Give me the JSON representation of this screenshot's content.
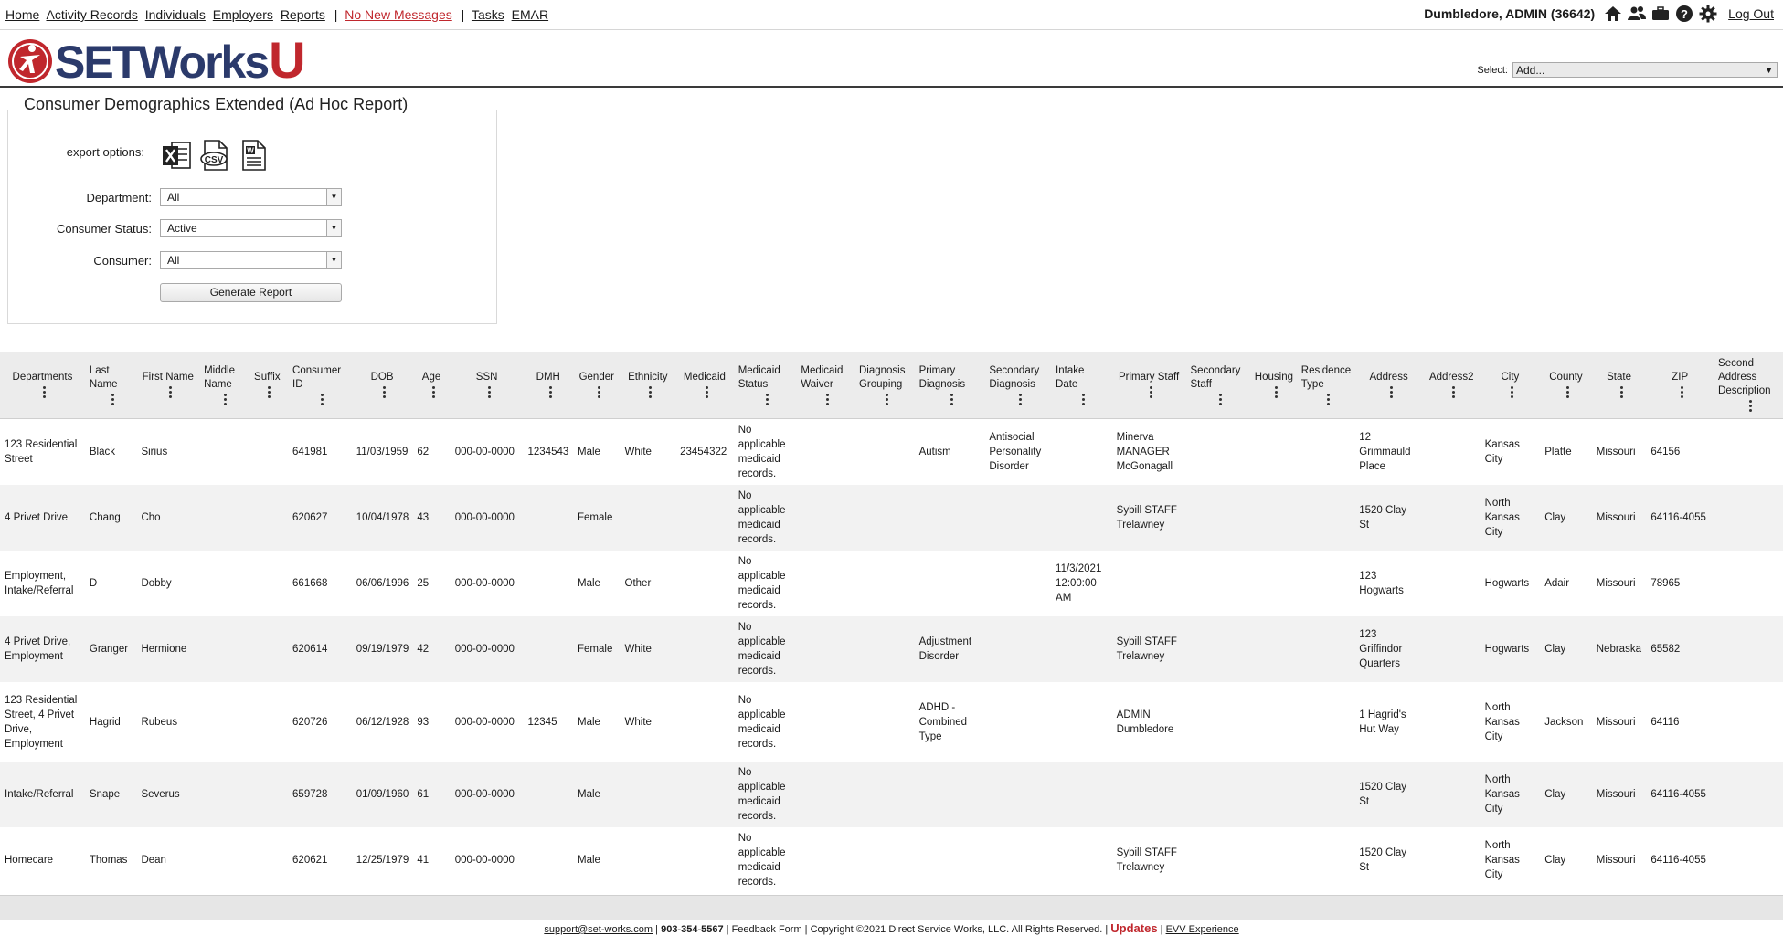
{
  "nav": {
    "links": [
      "Home",
      "Activity Records",
      "Individuals",
      "Employers",
      "Reports"
    ],
    "messages": "No New Messages",
    "links2": [
      "Tasks",
      "EMAR"
    ],
    "separator": "|"
  },
  "user": {
    "name": "Dumbledore, ADMIN",
    "id": "(36642)",
    "logout": "Log Out"
  },
  "logo": {
    "text": "SETWorks",
    "accent": "U"
  },
  "add_select": {
    "label": "Select:",
    "value": "Add..."
  },
  "report": {
    "title": "Consumer Demographics Extended (Ad Hoc Report)",
    "export_label": "export options:",
    "department_label": "Department:",
    "department_value": "All",
    "status_label": "Consumer Status:",
    "status_value": "Active",
    "consumer_label": "Consumer:",
    "consumer_value": "All",
    "generate_label": "Generate Report"
  },
  "table": {
    "columns": [
      "Departments",
      "Last Name",
      "First Name",
      "Middle Name",
      "Suffix",
      "Consumer ID",
      "DOB",
      "Age",
      "SSN",
      "DMH",
      "Gender",
      "Ethnicity",
      "Medicaid",
      "Medicaid Status",
      "Medicaid Waiver",
      "Diagnosis Grouping",
      "Primary Diagnosis",
      "Secondary Diagnosis",
      "Intake Date",
      "Primary Staff",
      "Secondary Staff",
      "Housing",
      "Residence Type",
      "Address",
      "Address2",
      "City",
      "County",
      "State",
      "ZIP",
      "Second Address Description"
    ],
    "rows": [
      [
        "123 Residential Street",
        "Black",
        "Sirius",
        "",
        "",
        "641981",
        "11/03/1959",
        "62",
        "000-00-0000",
        "1234543",
        "Male",
        "White",
        "23454322",
        "No applicable medicaid records.",
        "",
        "",
        "Autism",
        "Antisocial Personality Disorder",
        "",
        "Minerva MANAGER McGonagall",
        "",
        "",
        "",
        "12 Grimmauld Place",
        "",
        "Kansas City",
        "Platte",
        "Missouri",
        "64156",
        ""
      ],
      [
        "4 Privet Drive",
        "Chang",
        "Cho",
        "",
        "",
        "620627",
        "10/04/1978",
        "43",
        "000-00-0000",
        "",
        "Female",
        "",
        "",
        "No applicable medicaid records.",
        "",
        "",
        "",
        "",
        "",
        "Sybill STAFF Trelawney",
        "",
        "",
        "",
        "1520 Clay St",
        "",
        "North Kansas City",
        "Clay",
        "Missouri",
        "64116-4055",
        ""
      ],
      [
        "Employment, Intake/Referral",
        "D",
        "Dobby",
        "",
        "",
        "661668",
        "06/06/1996",
        "25",
        "000-00-0000",
        "",
        "Male",
        "Other",
        "",
        "No applicable medicaid records.",
        "",
        "",
        "",
        "",
        "11/3/2021 12:00:00 AM",
        "",
        "",
        "",
        "",
        "123 Hogwarts",
        "",
        "Hogwarts",
        "Adair",
        "Missouri",
        "78965",
        ""
      ],
      [
        "4 Privet Drive, Employment",
        "Granger",
        "Hermione",
        "",
        "",
        "620614",
        "09/19/1979",
        "42",
        "000-00-0000",
        "",
        "Female",
        "White",
        "",
        "No applicable medicaid records.",
        "",
        "",
        "Adjustment Disorder",
        "",
        "",
        "Sybill STAFF Trelawney",
        "",
        "",
        "",
        "123 Griffindor Quarters",
        "",
        "Hogwarts",
        "Clay",
        "Nebraska",
        "65582",
        ""
      ],
      [
        "123 Residential Street, 4 Privet Drive, Employment",
        "Hagrid",
        "Rubeus",
        "",
        "",
        "620726",
        "06/12/1928",
        "93",
        "000-00-0000",
        "12345",
        "Male",
        "White",
        "",
        "No applicable medicaid records.",
        "",
        "",
        "ADHD - Combined Type",
        "",
        "",
        "ADMIN Dumbledore",
        "",
        "",
        "",
        "1 Hagrid's Hut Way",
        "",
        "North Kansas City",
        "Jackson",
        "Missouri",
        "64116",
        ""
      ],
      [
        "Intake/Referral",
        "Snape",
        "Severus",
        "",
        "",
        "659728",
        "01/09/1960",
        "61",
        "000-00-0000",
        "",
        "Male",
        "",
        "",
        "No applicable medicaid records.",
        "",
        "",
        "",
        "",
        "",
        "",
        "",
        "",
        "",
        "1520 Clay St",
        "",
        "North Kansas City",
        "Clay",
        "Missouri",
        "64116-4055",
        ""
      ],
      [
        "Homecare",
        "Thomas",
        "Dean",
        "",
        "",
        "620621",
        "12/25/1979",
        "41",
        "000-00-0000",
        "",
        "Male",
        "",
        "",
        "No applicable medicaid records.",
        "",
        "",
        "",
        "",
        "",
        "Sybill STAFF Trelawney",
        "",
        "",
        "",
        "1520 Clay St",
        "",
        "North Kansas City",
        "Clay",
        "Missouri",
        "64116-4055",
        ""
      ]
    ]
  },
  "footer": {
    "email": "support@set-works.com",
    "phone": "903-354-5567",
    "feedback": "Feedback Form",
    "copyright": "Copyright ©2021 Direct Service Works, LLC. All Rights Reserved.",
    "updates": "Updates",
    "evv": "EVV Experience"
  },
  "icons": [
    "home-icon",
    "people-icon",
    "briefcase-icon",
    "help-icon",
    "gear-icon",
    "excel-icon",
    "csv-icon",
    "word-icon"
  ]
}
